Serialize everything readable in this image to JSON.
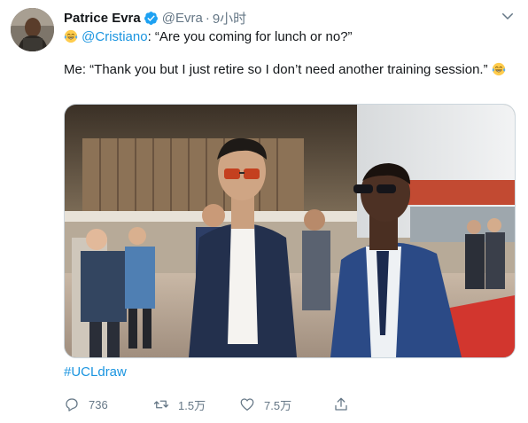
{
  "tweet": {
    "author_name": "Patrice Evra",
    "handle": "@Evra",
    "separator": "·",
    "time": "9小时",
    "line1_mention": "@Cristiano",
    "line1_text": ": “Are you coming for lunch or no?”",
    "line2_text": "Me: “Thank you but I just retire so I don’t need another training session.”",
    "hashtag": "#UCLdraw",
    "emoji_name": "face-with-tears-of-joy",
    "verified_color": "#1da1f2"
  },
  "actions": {
    "reply_count": "736",
    "retweet_count": "1.5万",
    "like_count": "7.5万"
  },
  "colors": {
    "link": "#1b95e0",
    "muted": "#657786",
    "text": "#14171a"
  }
}
